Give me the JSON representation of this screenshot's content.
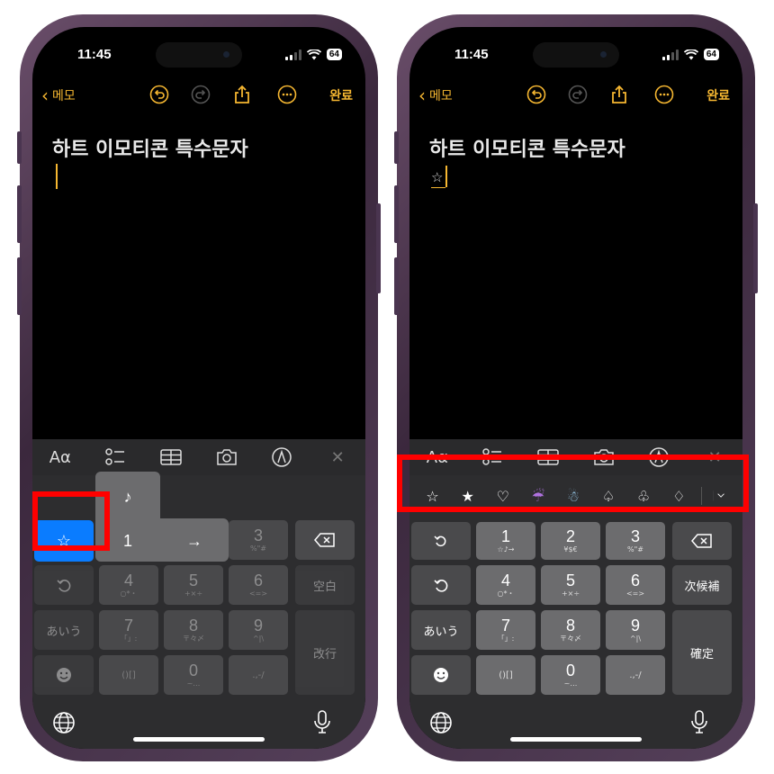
{
  "colors": {
    "accent": "#f6b731",
    "highlight": "#ff0000",
    "key_blue": "#0a7cff"
  },
  "left": {
    "status": {
      "time": "11:45",
      "battery": "64"
    },
    "nav": {
      "back_label": "메모",
      "done_label": "완료"
    },
    "note": {
      "title": "하트 이모티콘 특수문자"
    },
    "toolbar": {
      "text_format": "Aα",
      "close": "✕"
    },
    "keyboard": {
      "popup_up": "♪",
      "popup_center": "1",
      "popup_right": "→",
      "selected_key": "☆",
      "k3": {
        "main": "3",
        "sub": "%\"#"
      },
      "k4": {
        "main": "4",
        "sub": "○*・"
      },
      "k5": {
        "main": "5",
        "sub": "+×÷"
      },
      "k6": {
        "main": "6",
        "sub": "<=>"
      },
      "k7": {
        "main": "7",
        "sub": "「」:"
      },
      "k8": {
        "main": "8",
        "sub": "〒々〆"
      },
      "k9": {
        "main": "9",
        "sub": "^|\\"
      },
      "k0": {
        "main": "0",
        "sub": "~…"
      },
      "brackets": "()[]",
      "punct": ".,-/",
      "space_label": "空白",
      "hiragana_label": "あいう",
      "return_label": "改行"
    }
  },
  "right": {
    "status": {
      "time": "11:45",
      "battery": "64"
    },
    "nav": {
      "back_label": "메모",
      "done_label": "완료"
    },
    "note": {
      "title": "하트 이모티콘 특수문자",
      "typed": "☆"
    },
    "toolbar": {
      "text_format": "Aα",
      "close": "✕"
    },
    "suggestions": [
      "☆",
      "★",
      "♡",
      "☔",
      "☃",
      "♤",
      "♧",
      "♢"
    ],
    "keyboard": {
      "k1": {
        "main": "1",
        "sub": "☆♪→"
      },
      "k2": {
        "main": "2",
        "sub": "¥$€"
      },
      "k3": {
        "main": "3",
        "sub": "%\"#"
      },
      "k4": {
        "main": "4",
        "sub": "○*・"
      },
      "k5": {
        "main": "5",
        "sub": "+×÷"
      },
      "k6": {
        "main": "6",
        "sub": "<=>"
      },
      "k7": {
        "main": "7",
        "sub": "「」:"
      },
      "k8": {
        "main": "8",
        "sub": "〒々〆"
      },
      "k9": {
        "main": "9",
        "sub": "^|\\"
      },
      "k0": {
        "main": "0",
        "sub": "~…"
      },
      "brackets": "()[]",
      "punct": ".,-/",
      "candidates_label": "次候補",
      "hiragana_label": "あいう",
      "confirm_label": "確定"
    }
  },
  "icons": [
    "undo-icon",
    "redo-icon",
    "share-icon",
    "more-icon",
    "checklist-icon",
    "table-icon",
    "camera-icon",
    "markup-icon",
    "globe-icon",
    "mic-icon",
    "delete-icon",
    "emoji-icon"
  ]
}
